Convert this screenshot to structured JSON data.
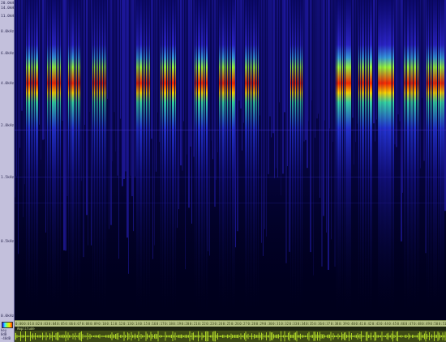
{
  "frequency_scale": {
    "labels": [
      "20.0kHz",
      "14.0kHz",
      "11.0kHz",
      "8.0kHz",
      "6.0kHz",
      "4.0kHz",
      "2.8kHz",
      "1.5kHz",
      "0.5kHz",
      "0.0kHz"
    ]
  },
  "time_ruler": {
    "ticks": [
      "0:00",
      "0:01",
      "0:02",
      "0:03",
      "0:04",
      "0:05",
      "0:06",
      "0:07",
      "0:08",
      "0:09",
      "0:10",
      "0:11",
      "0:12",
      "0:13",
      "0:14",
      "0:15",
      "0:16",
      "0:17",
      "0:18",
      "0:19",
      "0:20",
      "0:21",
      "0:22",
      "0:23",
      "0:24",
      "0:25",
      "0:26",
      "0:27",
      "0:28",
      "0:29",
      "0:30",
      "0:31",
      "0:32",
      "0:33",
      "0:34",
      "0:35",
      "0:36",
      "0:37",
      "0:38",
      "0:39",
      "0:40",
      "0:41",
      "0:42",
      "0:43",
      "0:44",
      "0:45",
      "0:46",
      "0:47",
      "0:48",
      "0:49",
      "0:50",
      "0:51"
    ]
  },
  "waveform_header": {
    "label": "Amplitude"
  },
  "corner": {
    "text": [
      "key",
      "0dB",
      "-48dB"
    ]
  },
  "colors": {
    "background": "#00001c",
    "low_energy": "#1a0cff",
    "mid_energy": "#38f0ff",
    "high_energy": "#a8ff2a",
    "peak_energy": "#ff3000",
    "waveform": "#b6e02a"
  },
  "icons": {
    "colormap": "colormap-legend"
  }
}
